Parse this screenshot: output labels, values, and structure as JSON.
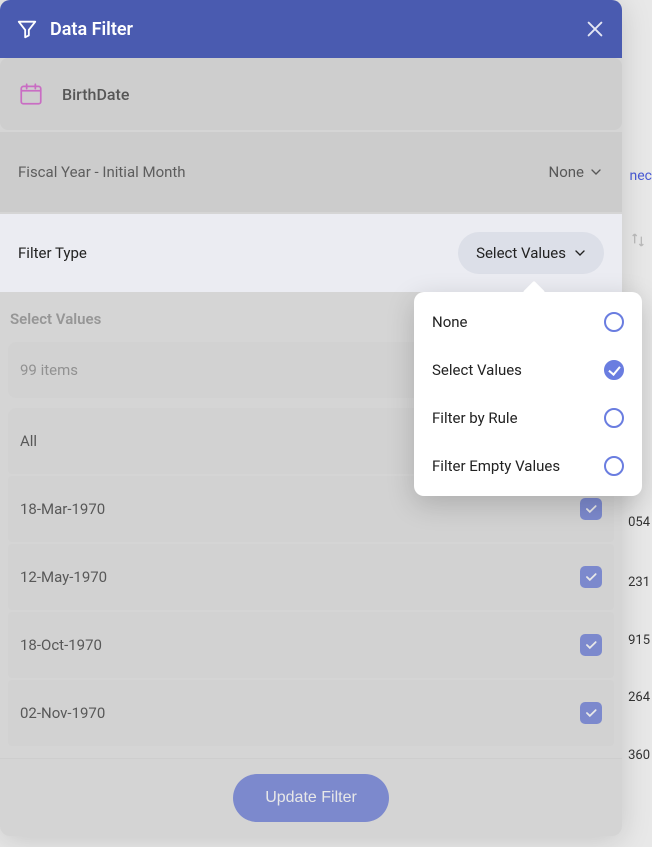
{
  "header": {
    "title": "Data Filter"
  },
  "column": {
    "name": "BirthDate"
  },
  "fiscal": {
    "label": "Fiscal Year - Initial Month",
    "value": "None"
  },
  "filterType": {
    "label": "Filter Type",
    "value": "Select Values"
  },
  "selectValues": {
    "header": "Select Values",
    "count": "99 items",
    "all": "All",
    "items": [
      "18-Mar-1970",
      "12-May-1970",
      "18-Oct-1970",
      "02-Nov-1970"
    ]
  },
  "footer": {
    "updateLabel": "Update Filter"
  },
  "popover": {
    "options": [
      {
        "label": "None",
        "selected": false
      },
      {
        "label": "Select Values",
        "selected": true
      },
      {
        "label": "Filter by Rule",
        "selected": false
      },
      {
        "label": "Filter Empty Values",
        "selected": false
      }
    ]
  },
  "background": {
    "link": "nec",
    "rows": [
      "054",
      "231",
      "915",
      "264",
      "360"
    ]
  }
}
